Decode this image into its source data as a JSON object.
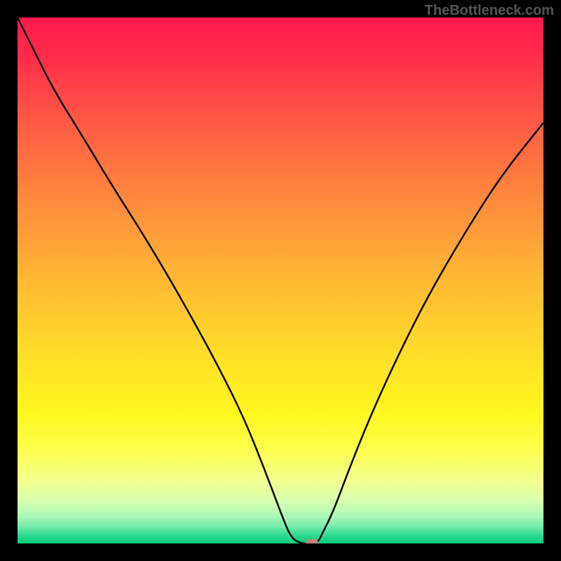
{
  "watermark": "TheBottleneck.com",
  "chart_data": {
    "type": "line",
    "title": "",
    "xlabel": "",
    "ylabel": "",
    "xlim": [
      0,
      100
    ],
    "ylim": [
      0,
      100
    ],
    "x": [
      0,
      3,
      7,
      12,
      18,
      25,
      32,
      38,
      43,
      47,
      50,
      52,
      54,
      55,
      57,
      58,
      60,
      63,
      67,
      72,
      78,
      85,
      92,
      100
    ],
    "y": [
      100,
      94,
      86,
      78,
      68,
      57,
      45,
      34,
      24,
      14,
      6,
      1,
      0,
      0,
      0,
      2,
      6,
      14,
      24,
      35,
      47,
      59,
      70,
      80
    ],
    "marker": {
      "x": 56,
      "y": 0
    },
    "gradient_stops": [
      {
        "offset": 0.0,
        "color": "#ff1a4d"
      },
      {
        "offset": 0.08,
        "color": "#ff2e4b"
      },
      {
        "offset": 0.2,
        "color": "#ff5a45"
      },
      {
        "offset": 0.35,
        "color": "#ff8a3d"
      },
      {
        "offset": 0.5,
        "color": "#ffb933"
      },
      {
        "offset": 0.65,
        "color": "#ffe028"
      },
      {
        "offset": 0.75,
        "color": "#fff61e"
      },
      {
        "offset": 0.82,
        "color": "#feff4a"
      },
      {
        "offset": 0.88,
        "color": "#f3ff8f"
      },
      {
        "offset": 0.92,
        "color": "#d8ffb0"
      },
      {
        "offset": 0.95,
        "color": "#a8f7b8"
      },
      {
        "offset": 0.97,
        "color": "#6ee9a8"
      },
      {
        "offset": 0.985,
        "color": "#2bd98f"
      },
      {
        "offset": 1.0,
        "color": "#0bcc79"
      }
    ]
  }
}
